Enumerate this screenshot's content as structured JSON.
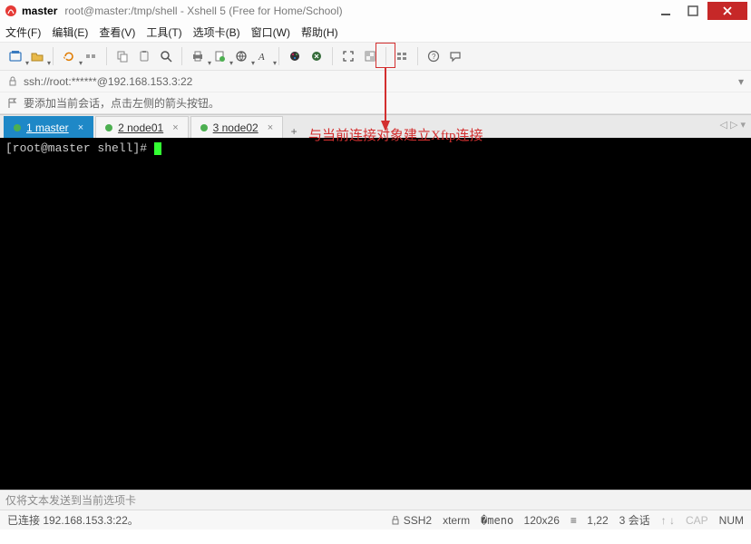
{
  "title": {
    "main": "master",
    "sub": "root@master:/tmp/shell - Xshell 5 (Free for Home/School)"
  },
  "menus": [
    "文件(F)",
    "编辑(E)",
    "查看(V)",
    "工具(T)",
    "选项卡(B)",
    "窗口(W)",
    "帮助(H)"
  ],
  "address": "ssh://root:******@192.168.153.3:22",
  "hint": "要添加当前会话，点击左侧的箭头按钮。",
  "tabs": [
    {
      "label": "1 master",
      "active": true
    },
    {
      "label": "2 node01",
      "active": false
    },
    {
      "label": "3 node02",
      "active": false
    }
  ],
  "terminal": {
    "prompt": "[root@master shell]# "
  },
  "annotation": "与当前连接对象建立Xftp连接",
  "sendbar": "仅将文本发送到当前选项卡",
  "status": {
    "conn": "已连接 192.168.153.3:22。",
    "proto": "SSH2",
    "term": "xterm",
    "size": "120x26",
    "rows": "1,22",
    "sess": "3 会话",
    "cap": "CAP",
    "num": "NUM"
  }
}
